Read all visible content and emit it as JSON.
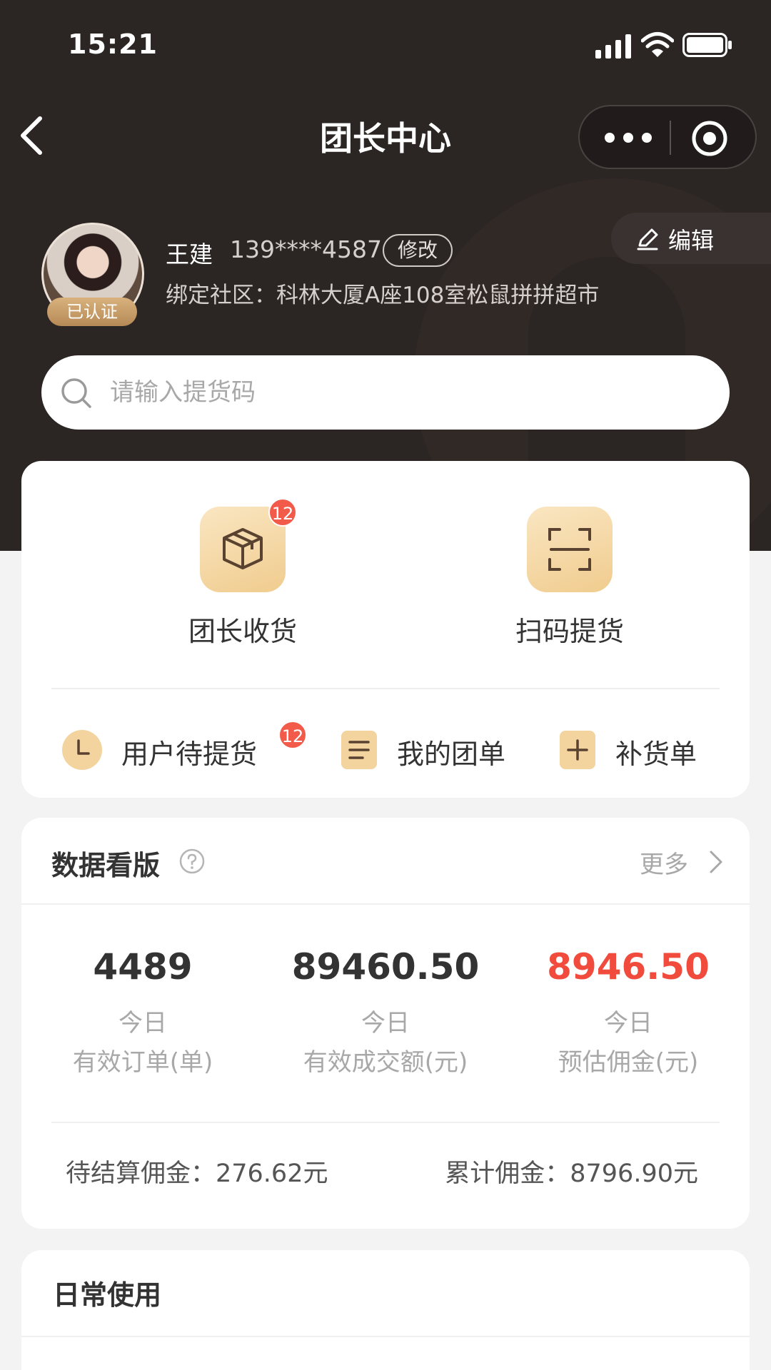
{
  "status_bar": {
    "time": "15:21"
  },
  "nav": {
    "title": "团长中心"
  },
  "profile": {
    "name": "王建",
    "phone": "139****4587",
    "modify_label": "修改",
    "verified_label": "已认证",
    "community": "绑定社区：科林大厦A座108室松鼠拼拼超市",
    "edit_label": "编辑"
  },
  "search": {
    "placeholder": "请输入提货码"
  },
  "actions": {
    "receive": {
      "label": "团长收货",
      "badge": "12",
      "icon": "box-icon"
    },
    "scan": {
      "label": "扫码提货",
      "icon": "scan-icon"
    },
    "pending": {
      "label": "用户待提货",
      "badge": "12",
      "icon": "clock-icon"
    },
    "mygroup": {
      "label": "我的团单",
      "icon": "list-icon"
    },
    "restock": {
      "label": "补货单",
      "icon": "plus-icon"
    }
  },
  "dashboard": {
    "title": "数据看版",
    "more_label": "更多",
    "stats": [
      {
        "value": "4489",
        "period": "今日",
        "caption": "有效订单(单)"
      },
      {
        "value": "89460.50",
        "period": "今日",
        "caption": "有效成交额(元)"
      },
      {
        "value": "8946.50",
        "period": "今日",
        "caption": "预估佣金(元)"
      }
    ],
    "pending_commission": "待结算佣金：276.62元",
    "total_commission": "累计佣金：8796.90元"
  },
  "daily": {
    "title": "日常使用"
  },
  "colors": {
    "header_bg": "#2b2523",
    "accent_gold": "#f0cc8e",
    "badge_red": "#f25b4a",
    "commission_red": "#f04b3c"
  }
}
